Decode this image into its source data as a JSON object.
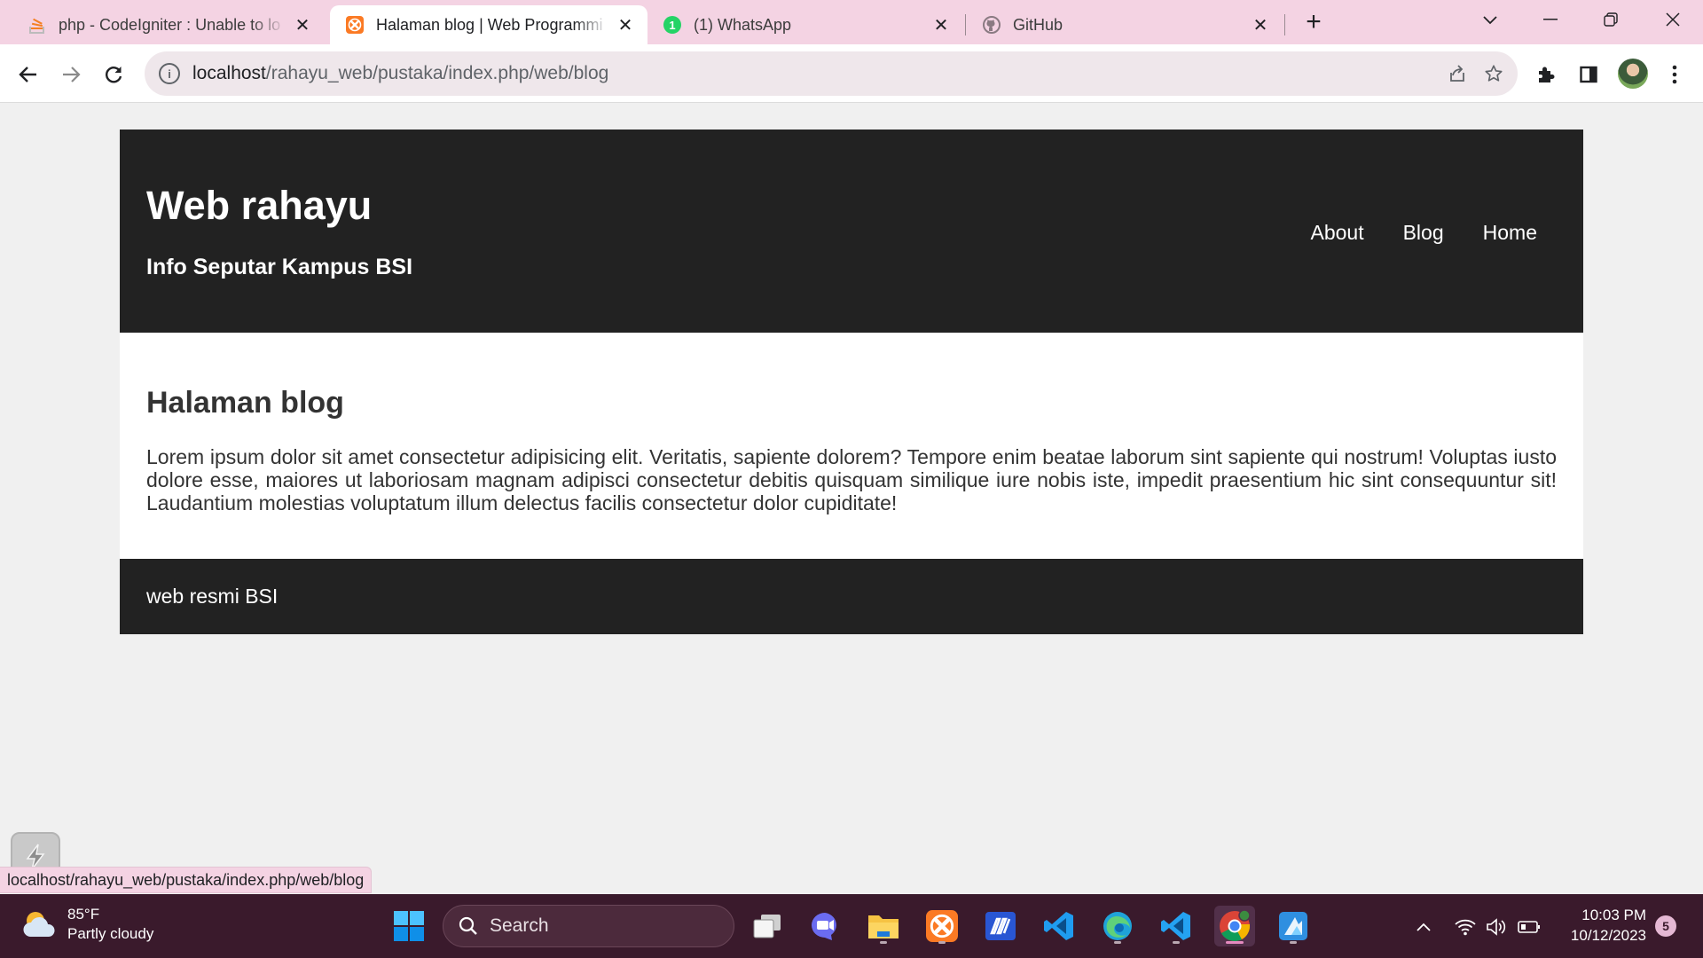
{
  "browser": {
    "tabs": [
      {
        "title": "php - CodeIgniter : Unable to lo",
        "favicon": "stackoverflow-icon",
        "active": false
      },
      {
        "title": "Halaman blog | Web Programmi",
        "favicon": "xampp-icon",
        "active": true
      },
      {
        "title": "(1) WhatsApp",
        "favicon": "whatsapp-icon",
        "active": false,
        "badge": "1"
      },
      {
        "title": "GitHub",
        "favicon": "github-icon",
        "active": false
      }
    ],
    "address": {
      "host": "localhost",
      "path": "/rahayu_web/pustaka/index.php/web/blog"
    },
    "status_url": "localhost/rahayu_web/pustaka/index.php/web/blog"
  },
  "site": {
    "title": "Web rahayu",
    "subtitle": "Info Seputar Kampus BSI",
    "nav": [
      "About",
      "Blog",
      "Home"
    ],
    "heading": "Halaman blog",
    "body": "Lorem ipsum dolor sit amet consectetur adipisicing elit. Veritatis, sapiente dolorem? Tempore enim beatae laborum sint sapiente qui nostrum! Voluptas iusto dolore esse, maiores ut laboriosam magnam adipisci consectetur debitis quisquam similique iure nobis iste, impedit praesentium hic sint consequuntur sit! Laudantium molestias voluptatum illum delectus facilis consectetur dolor cupiditate!",
    "footer": "web resmi BSI"
  },
  "taskbar": {
    "weather": {
      "temp": "85°F",
      "condition": "Partly cloudy"
    },
    "search_label": "Search",
    "apps": [
      "windows-start-icon",
      "task-view-icon",
      "chat-icon",
      "file-explorer-icon",
      "xampp-icon",
      "sublime-text-icon",
      "vscode-icon",
      "edge-icon",
      "vscode-icon",
      "chrome-icon",
      "azure-data-studio-icon"
    ],
    "time": "10:03 PM",
    "date": "10/12/2023",
    "notifications": "5"
  },
  "colors": {
    "tab_strip": "#f4d3e3",
    "site_dark": "#222222",
    "taskbar": "#3a1a2c"
  }
}
